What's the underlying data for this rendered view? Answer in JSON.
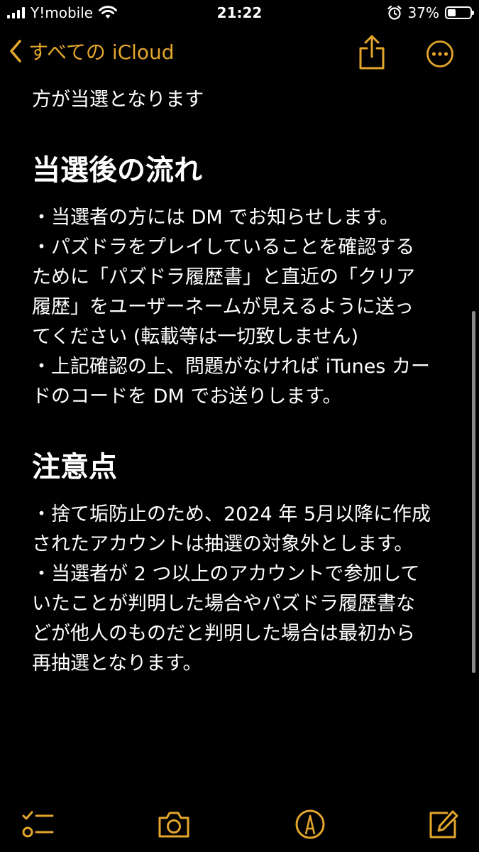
{
  "status_bar": {
    "carrier": "Y!mobile",
    "time": "21:22",
    "battery_percent": "37%",
    "battery_level": 0.37
  },
  "nav": {
    "back_label": "すべての iCloud",
    "accent_color": "#e3a62d"
  },
  "note": {
    "partial_top": "方が当選となります",
    "sections": [
      {
        "heading": "当選後の流れ",
        "lines": [
          "・当選者の方には DM でお知らせします。",
          "・パズドラをプレイしていることを確認する",
          "ために「パズドラ履歴書」と直近の「クリア",
          "履歴」をユーザーネームが見えるように送っ",
          "てください (転載等は一切致しません)",
          "・上記確認の上、問題がなければ iTunes カー",
          "ドのコードを DM でお送りします。"
        ]
      },
      {
        "heading": "注意点",
        "lines": [
          "・捨て垢防止のため、2024 年 5月以降に作成",
          "されたアカウントは抽選の対象外とします。",
          "・当選者が 2 つ以上のアカウントで参加して",
          "いたことが判明した場合やパズドラ履歴書な",
          "どが他人のものだと判明した場合は最初から",
          "再抽選となります。"
        ]
      }
    ]
  },
  "icons": {
    "back": "chevron-left-icon",
    "share": "share-icon",
    "more": "ellipsis-circle-icon",
    "checklist": "checklist-icon",
    "camera": "camera-icon",
    "markup": "pen-circle-icon",
    "compose": "compose-icon"
  }
}
